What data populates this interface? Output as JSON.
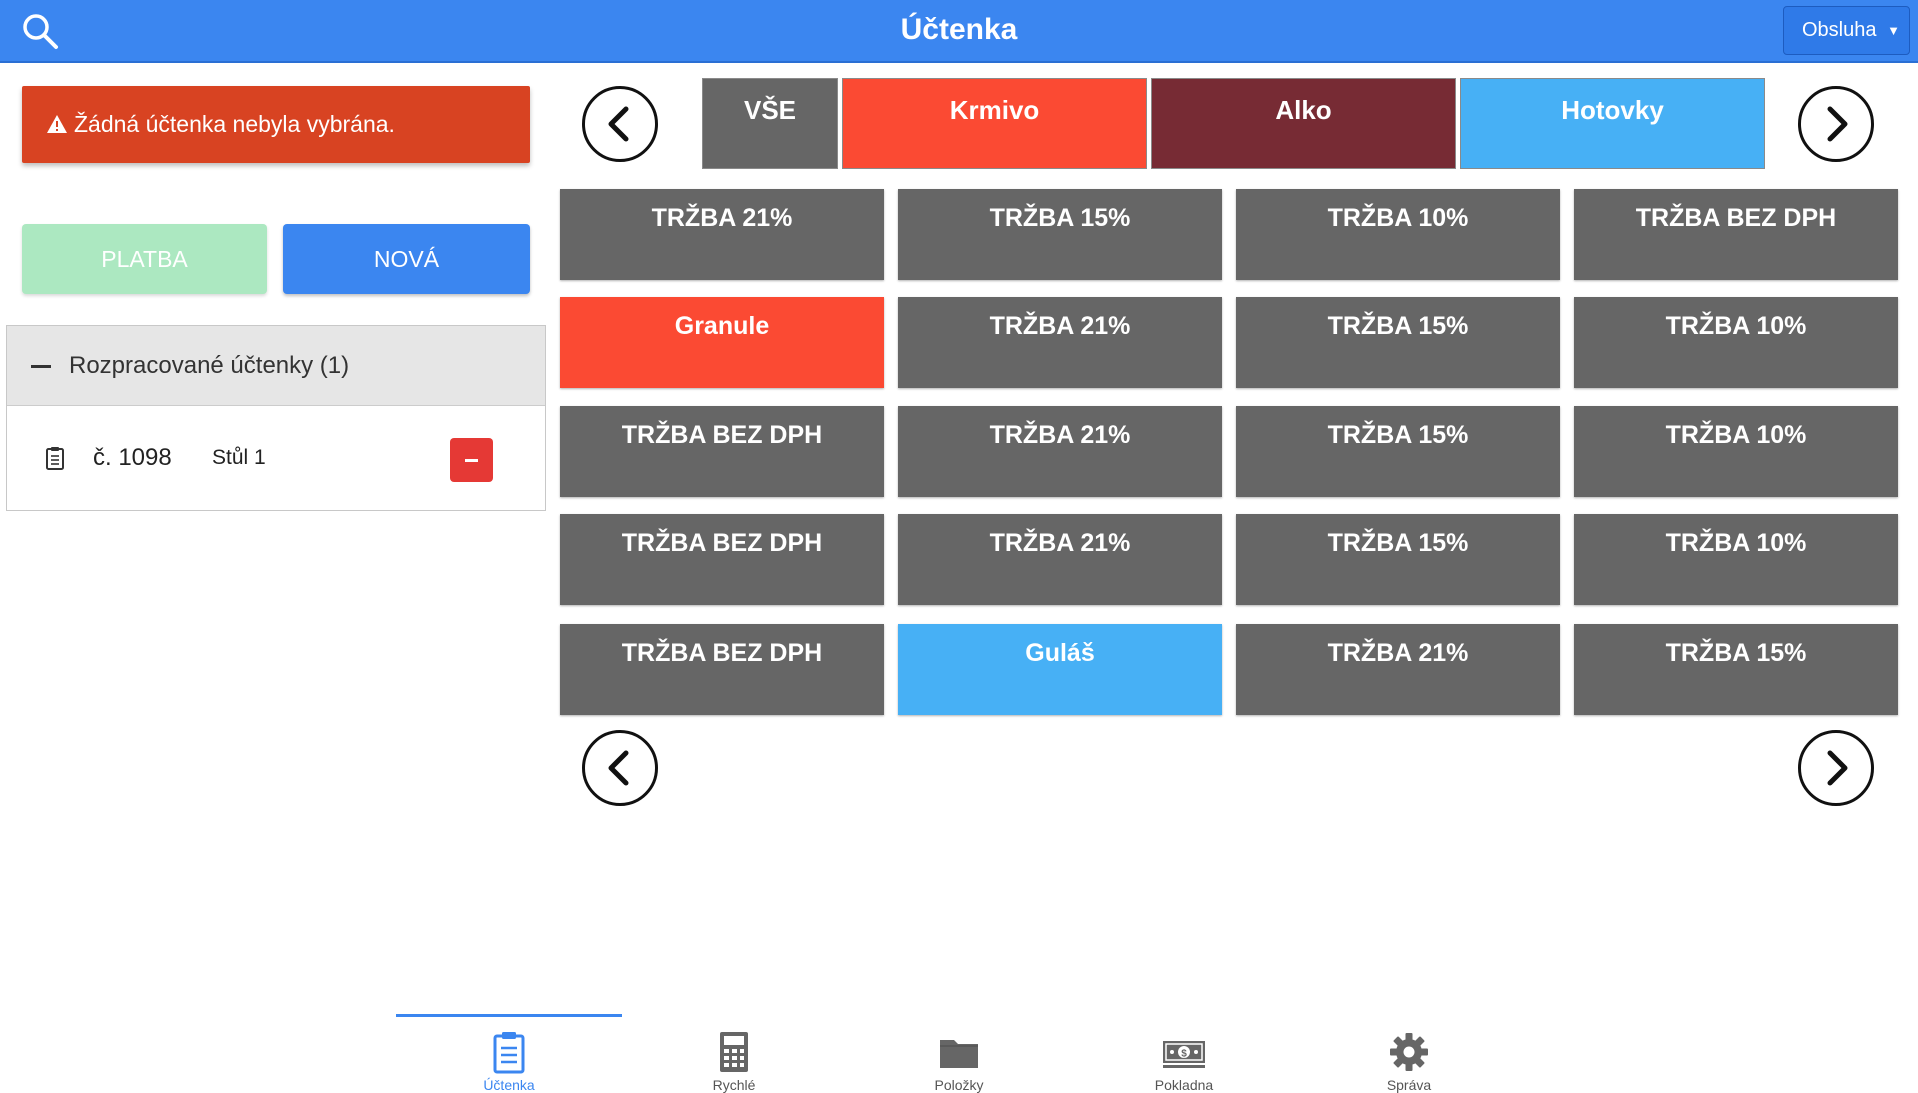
{
  "header": {
    "title": "Účtenka",
    "role_select": "Obsluha"
  },
  "alert": {
    "text": "Žádná účtenka nebyla vybrána."
  },
  "actions": {
    "pay_label": "PLATBA",
    "new_label": "NOVÁ"
  },
  "wip": {
    "header": "Rozpracované účtenky (1)",
    "items": [
      {
        "number": "č. 1098",
        "table": "Stůl 1"
      }
    ]
  },
  "categories": [
    {
      "label": "VŠE",
      "color": "#666666"
    },
    {
      "label": "Krmivo",
      "color": "#fb4a33"
    },
    {
      "label": "Alko",
      "color": "#772b34"
    },
    {
      "label": "Hotovky",
      "color": "#47b0f5"
    }
  ],
  "products": [
    [
      {
        "label": "TRŽBA 21%",
        "color": "#666666"
      },
      {
        "label": "TRŽBA 15%",
        "color": "#666666"
      },
      {
        "label": "TRŽBA 10%",
        "color": "#666666"
      },
      {
        "label": "TRŽBA BEZ DPH",
        "color": "#666666"
      }
    ],
    [
      {
        "label": "Granule",
        "color": "#fb4a33"
      },
      {
        "label": "TRŽBA 21%",
        "color": "#666666"
      },
      {
        "label": "TRŽBA 15%",
        "color": "#666666"
      },
      {
        "label": "TRŽBA 10%",
        "color": "#666666"
      }
    ],
    [
      {
        "label": "TRŽBA BEZ DPH",
        "color": "#666666"
      },
      {
        "label": "TRŽBA 21%",
        "color": "#666666"
      },
      {
        "label": "TRŽBA 15%",
        "color": "#666666"
      },
      {
        "label": "TRŽBA 10%",
        "color": "#666666"
      }
    ],
    [
      {
        "label": "TRŽBA BEZ DPH",
        "color": "#666666"
      },
      {
        "label": "TRŽBA 21%",
        "color": "#666666"
      },
      {
        "label": "TRŽBA 15%",
        "color": "#666666"
      },
      {
        "label": "TRŽBA 10%",
        "color": "#666666"
      }
    ],
    [
      {
        "label": "TRŽBA BEZ DPH",
        "color": "#666666"
      },
      {
        "label": "Guláš",
        "color": "#47b0f5"
      },
      {
        "label": "TRŽBA 21%",
        "color": "#666666"
      },
      {
        "label": "TRŽBA 15%",
        "color": "#666666"
      }
    ]
  ],
  "bottom_nav": [
    {
      "label": "Účtenka",
      "icon": "receipt-icon",
      "active": true
    },
    {
      "label": "Rychlé",
      "icon": "calculator-icon",
      "active": false
    },
    {
      "label": "Položky",
      "icon": "folder-icon",
      "active": false
    },
    {
      "label": "Pokladna",
      "icon": "cash-icon",
      "active": false
    },
    {
      "label": "Správa",
      "icon": "gear-icon",
      "active": false
    }
  ],
  "colors": {
    "primary": "#3b86f0",
    "danger": "#d84322",
    "tile": "#666666"
  }
}
